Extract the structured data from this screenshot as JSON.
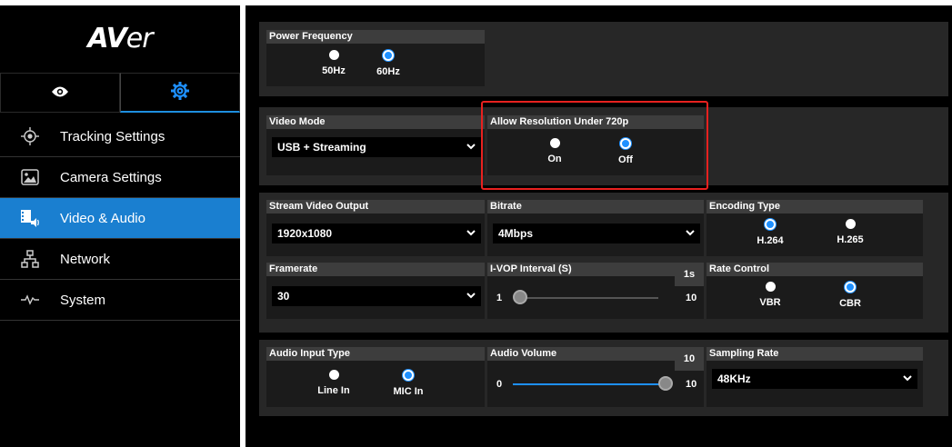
{
  "brand": {
    "logo_bold": "AV",
    "logo_rest": "er"
  },
  "modes": [
    {
      "name": "view",
      "icon": "eye-icon"
    },
    {
      "name": "settings",
      "icon": "gear-icon"
    }
  ],
  "nav": [
    {
      "label": "Tracking Settings",
      "icon": "target-icon"
    },
    {
      "label": "Camera Settings",
      "icon": "image-icon"
    },
    {
      "label": "Video & Audio",
      "icon": "video-audio-icon"
    },
    {
      "label": "Network",
      "icon": "network-icon"
    },
    {
      "label": "System",
      "icon": "pulse-icon"
    }
  ],
  "power_frequency": {
    "title": "Power Frequency",
    "options": [
      "50Hz",
      "60Hz"
    ],
    "selected": "60Hz"
  },
  "video_mode": {
    "title": "Video Mode",
    "value": "USB + Streaming"
  },
  "allow_res": {
    "title": "Allow Resolution Under 720p",
    "options": [
      "On",
      "Off"
    ],
    "selected": "Off"
  },
  "stream_output": {
    "title": "Stream Video Output",
    "value": "1920x1080"
  },
  "bitrate": {
    "title": "Bitrate",
    "value": "4Mbps"
  },
  "encoding": {
    "title": "Encoding Type",
    "options": [
      "H.264",
      "H.265"
    ],
    "selected": "H.264"
  },
  "framerate": {
    "title": "Framerate",
    "value": "30"
  },
  "ivop": {
    "title": "I-VOP Interval (S)",
    "value_tag": "1s",
    "min": "1",
    "max": "10",
    "value": 1
  },
  "rate_control": {
    "title": "Rate Control",
    "options": [
      "VBR",
      "CBR"
    ],
    "selected": "CBR"
  },
  "audio_input": {
    "title": "Audio Input Type",
    "options": [
      "Line In",
      "MIC In"
    ],
    "selected": "MIC In"
  },
  "audio_volume": {
    "title": "Audio Volume",
    "value_tag": "10",
    "min": "0",
    "max": "10",
    "value": 10
  },
  "sampling_rate": {
    "title": "Sampling Rate",
    "value": "48KHz"
  },
  "colors": {
    "accent": "#1e90ff",
    "active_nav": "#1a7fd0",
    "highlight": "#e8211f"
  }
}
